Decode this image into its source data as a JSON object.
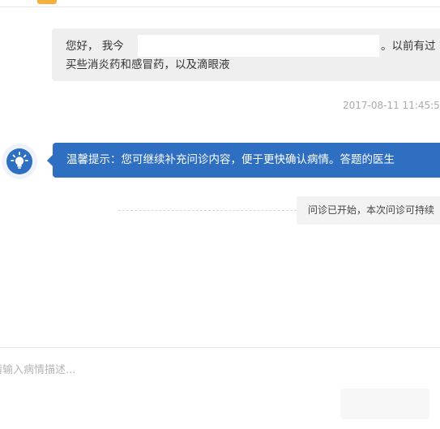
{
  "conversation": {
    "user_message": {
      "line1_start": "您好， 我今",
      "line1_end": "。以前有过",
      "line2": "买些消炎药和感冒药，以及滴眼液"
    },
    "timestamp": "2017-08-11 11:45:5",
    "tip": {
      "icon": "lightbulb-icon",
      "text": "温馨提示：您可继续补充问诊内容，便于更快确认病情。答题的医生"
    },
    "status_text": "问诊已开始，本次问诊可持续"
  },
  "input": {
    "placeholder": "请输入病情描述..."
  },
  "colors": {
    "accent": "#2e6fc1",
    "user_bubble_bg": "#efefef",
    "status_bg": "#f3f3f3"
  }
}
